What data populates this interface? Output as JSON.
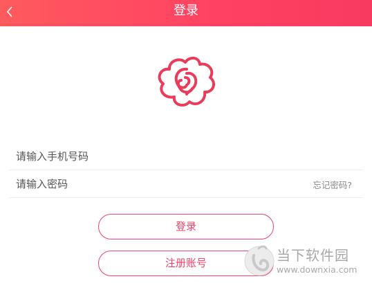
{
  "header": {
    "title": "登录",
    "back_icon": "chevron-left-icon"
  },
  "logo": {
    "icon": "flower-logo-icon",
    "color": "#ea3b5a"
  },
  "form": {
    "phone_placeholder": "请输入手机号码",
    "password_placeholder": "请输入密码",
    "forgot_label": "忘记密码?"
  },
  "buttons": {
    "login_label": "登录",
    "register_label": "注册账号"
  },
  "watermark": {
    "name": "当下软件园",
    "url": "www.downxia.com"
  },
  "colors": {
    "accent": "#f0426a",
    "header_start": "#ff5a5e",
    "header_end": "#f83a5f"
  }
}
